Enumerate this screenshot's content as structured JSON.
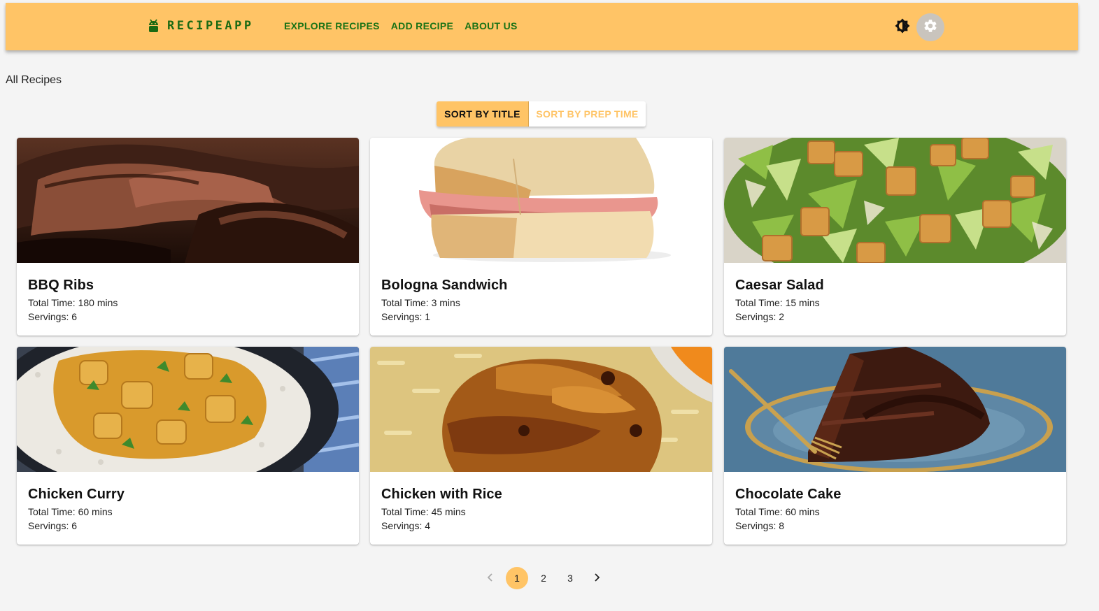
{
  "header": {
    "logo_icon": "android-icon",
    "logo_text": "RECIPEAPP",
    "nav": [
      {
        "label": "EXPLORE RECIPES"
      },
      {
        "label": "ADD RECIPE"
      },
      {
        "label": "ABOUT US"
      }
    ],
    "theme_icon": "brightness-icon",
    "settings_icon": "gear-icon"
  },
  "page": {
    "heading": "All Recipes"
  },
  "sort": {
    "by_title": "SORT BY TITLE",
    "by_prep_time": "SORT BY PREP TIME",
    "active": "by_title"
  },
  "recipes": [
    {
      "title": "BBQ Ribs",
      "total_time": "Total Time: 180 mins",
      "servings": "Servings: 6"
    },
    {
      "title": "Bologna Sandwich",
      "total_time": "Total Time: 3 mins",
      "servings": "Servings: 1"
    },
    {
      "title": "Caesar Salad",
      "total_time": "Total Time: 15 mins",
      "servings": "Servings: 2"
    },
    {
      "title": "Chicken Curry",
      "total_time": "Total Time: 60 mins",
      "servings": "Servings: 6"
    },
    {
      "title": "Chicken with Rice",
      "total_time": "Total Time: 45 mins",
      "servings": "Servings: 4"
    },
    {
      "title": "Chocolate Cake",
      "total_time": "Total Time: 60 mins",
      "servings": "Servings: 8"
    }
  ],
  "pagination": {
    "pages": [
      "1",
      "2",
      "3"
    ],
    "current": "1"
  },
  "colors": {
    "accent": "#ffc466",
    "nav_text": "#1a7215",
    "background": "#f4f4f4"
  }
}
